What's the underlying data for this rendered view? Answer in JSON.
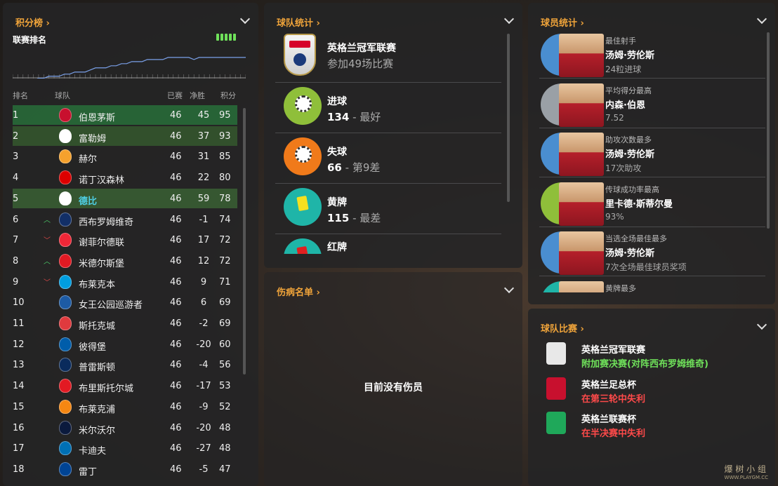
{
  "league": {
    "title": "积分榜",
    "subtitle": "联赛排名",
    "headers": {
      "pos": "排名",
      "team": "球队",
      "played": "已赛",
      "gd": "净胜",
      "pts": "积分"
    },
    "rank_trend": [
      18,
      17,
      17,
      16,
      16,
      15,
      15,
      14,
      14,
      14,
      13,
      13,
      12,
      12,
      12,
      11,
      10,
      10,
      10,
      9,
      9,
      8,
      8,
      7,
      7,
      7,
      6,
      6,
      6,
      6,
      5,
      5,
      5,
      5,
      5,
      6,
      5,
      5,
      5,
      5,
      5,
      5,
      5,
      5,
      5,
      5
    ],
    "rows": [
      {
        "pos": "1",
        "trend": "",
        "team": "伯恩茅斯",
        "played": "46",
        "gd": "45",
        "pts": "95",
        "highlight": "promo"
      },
      {
        "pos": "2",
        "trend": "",
        "team": "富勒姆",
        "played": "46",
        "gd": "37",
        "pts": "93",
        "highlight": "promo2"
      },
      {
        "pos": "3",
        "trend": "",
        "team": "赫尔",
        "played": "46",
        "gd": "31",
        "pts": "85",
        "highlight": ""
      },
      {
        "pos": "4",
        "trend": "",
        "team": "诺丁汉森林",
        "played": "46",
        "gd": "22",
        "pts": "80",
        "highlight": ""
      },
      {
        "pos": "5",
        "trend": "",
        "team": "德比",
        "played": "46",
        "gd": "59",
        "pts": "78",
        "highlight": "self"
      },
      {
        "pos": "6",
        "trend": "up",
        "team": "西布罗姆维奇",
        "played": "46",
        "gd": "-1",
        "pts": "74",
        "highlight": ""
      },
      {
        "pos": "7",
        "trend": "down",
        "team": "谢菲尔德联",
        "played": "46",
        "gd": "17",
        "pts": "72",
        "highlight": ""
      },
      {
        "pos": "8",
        "trend": "up",
        "team": "米德尔斯堡",
        "played": "46",
        "gd": "12",
        "pts": "72",
        "highlight": ""
      },
      {
        "pos": "9",
        "trend": "down",
        "team": "布莱克本",
        "played": "46",
        "gd": "9",
        "pts": "71",
        "highlight": ""
      },
      {
        "pos": "10",
        "trend": "",
        "team": "女王公园巡游者",
        "played": "46",
        "gd": "6",
        "pts": "69",
        "highlight": ""
      },
      {
        "pos": "11",
        "trend": "",
        "team": "斯托克城",
        "played": "46",
        "gd": "-2",
        "pts": "69",
        "highlight": ""
      },
      {
        "pos": "12",
        "trend": "",
        "team": "彼得堡",
        "played": "46",
        "gd": "-20",
        "pts": "60",
        "highlight": ""
      },
      {
        "pos": "13",
        "trend": "",
        "team": "普雷斯顿",
        "played": "46",
        "gd": "-4",
        "pts": "56",
        "highlight": ""
      },
      {
        "pos": "14",
        "trend": "",
        "team": "布里斯托尔城",
        "played": "46",
        "gd": "-17",
        "pts": "53",
        "highlight": ""
      },
      {
        "pos": "15",
        "trend": "",
        "team": "布莱克浦",
        "played": "46",
        "gd": "-9",
        "pts": "52",
        "highlight": ""
      },
      {
        "pos": "16",
        "trend": "",
        "team": "米尔沃尔",
        "played": "46",
        "gd": "-20",
        "pts": "48",
        "highlight": ""
      },
      {
        "pos": "17",
        "trend": "",
        "team": "卡迪夫",
        "played": "46",
        "gd": "-27",
        "pts": "48",
        "highlight": ""
      },
      {
        "pos": "18",
        "trend": "",
        "team": "雷丁",
        "played": "46",
        "gd": "-5",
        "pts": "47",
        "highlight": ""
      }
    ],
    "crest_colors": [
      "#c8102e",
      "#ffffff",
      "#f5a12d",
      "#dd0000",
      "#ffffff",
      "#122f67",
      "#ee2737",
      "#e21a23",
      "#009ee0",
      "#1d5ba4",
      "#e03a3e",
      "#005daa",
      "#0a2b5c",
      "#e21a23",
      "#f68712",
      "#0b1a3d",
      "#0070b5",
      "#004494"
    ]
  },
  "team_stats": {
    "title": "球队统计",
    "competition": {
      "name": "英格兰冠军联赛",
      "detail": "参加49场比赛"
    },
    "items": [
      {
        "label": "进球",
        "value": "134",
        "rank": " - 最好",
        "icon": "goal-ball-icon",
        "color": "#8fbf3a"
      },
      {
        "label": "失球",
        "value": "66",
        "rank": " - 第9差",
        "icon": "conceded-ball-icon",
        "color": "#f07a1a"
      },
      {
        "label": "黄牌",
        "value": "115",
        "rank": " - 最差",
        "icon": "yellow-card-icon",
        "color": "#1fb5a8"
      },
      {
        "label": "红牌",
        "value": "",
        "rank": "",
        "icon": "red-card-icon",
        "color": "#1fb5a8"
      }
    ]
  },
  "injuries": {
    "title": "伤病名单",
    "empty_text": "目前没有伤员"
  },
  "player_stats": {
    "title": "球员统计",
    "items": [
      {
        "category": "最佳射手",
        "name": "汤姆·劳伦斯",
        "detail": "24粒进球",
        "color": "#4a8ed0"
      },
      {
        "category": "平均得分最高",
        "name": "内森·伯恩",
        "detail": "7.52",
        "color": "#9aa0a6"
      },
      {
        "category": "助攻次数最多",
        "name": "汤姆·劳伦斯",
        "detail": "17次助攻",
        "color": "#4a8ed0"
      },
      {
        "category": "传球成功率最高",
        "name": "里卡德·斯蒂尔曼",
        "detail": "93%",
        "color": "#8fbf3a"
      },
      {
        "category": "当选全场最佳最多",
        "name": "汤姆·劳伦斯",
        "detail": "7次全场最佳球员奖项",
        "color": "#4a8ed0"
      },
      {
        "category": "黄牌最多",
        "name": "",
        "detail": "",
        "color": "#1fb5a8"
      }
    ]
  },
  "competitions": {
    "title": "球队比赛",
    "items": [
      {
        "name": "英格兰冠军联赛",
        "result": "附加赛决赛(对阵西布罗姆维奇)",
        "color": "#6fe15a",
        "icon": "efl-championship-icon"
      },
      {
        "name": "英格兰足总杯",
        "result": "在第三轮中失利",
        "color": "#ff4a4a",
        "icon": "fa-cup-icon"
      },
      {
        "name": "英格兰联赛杯",
        "result": "在半决赛中失利",
        "color": "#ff4a4a",
        "icon": "league-cup-icon"
      }
    ]
  },
  "watermark": {
    "brand": "爆 树 小 组",
    "url": "WWW.PLAYGM.CC"
  }
}
